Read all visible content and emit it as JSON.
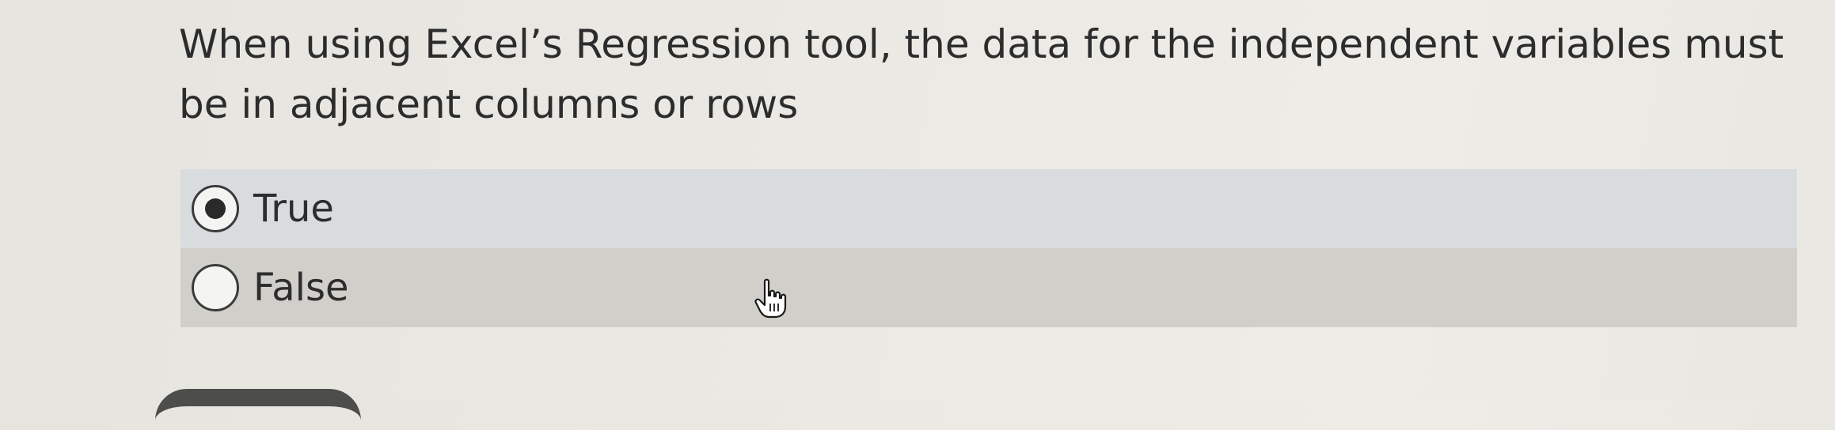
{
  "question": {
    "text": "When using Excel’s Regression tool, the data for the independent variables must be in adjacent columns or rows"
  },
  "options": [
    {
      "label": "True",
      "selected": true
    },
    {
      "label": "False",
      "selected": false
    }
  ],
  "colors": {
    "selected_row": "#d9dcdf",
    "unselected_row": "#d1cfca",
    "text": "#2c2c2c"
  },
  "icons": {
    "cursor": "hand-pointer-icon"
  }
}
